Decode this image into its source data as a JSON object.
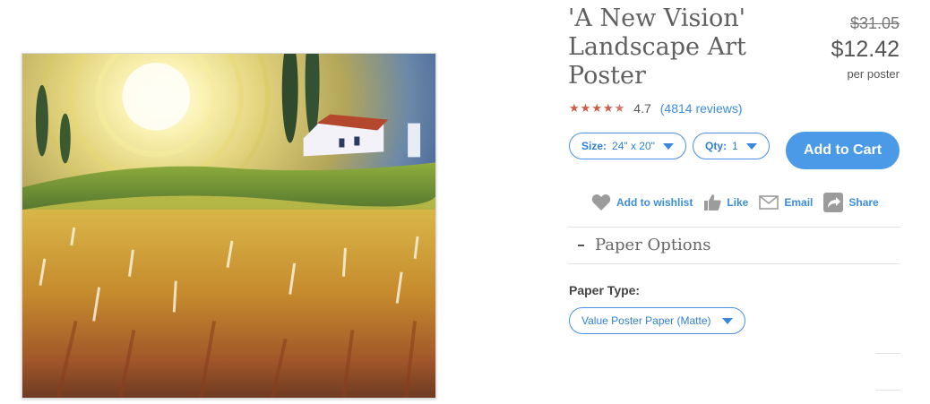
{
  "product": {
    "title": "'A New Vision' Landscape Art Poster",
    "price_old": "$31.05",
    "price_new": "$12.42",
    "price_unit": "per poster",
    "image_alt": "A New Vision painting"
  },
  "rating": {
    "stars": 4.7,
    "value": "4.7",
    "reviews": "(4814 reviews)",
    "star_color": "#cd5b45"
  },
  "options": {
    "size_key": "Size:",
    "size_value": "24\" x 20\"",
    "qty_key": "Qty:",
    "qty_value": "1",
    "add_to_cart": "Add to Cart"
  },
  "actions": {
    "wishlist": "Add to wishlist",
    "like": "Like",
    "email": "Email",
    "share": "Share"
  },
  "paper_options": {
    "section_title": "Paper Options",
    "paper_type_label": "Paper Type:",
    "paper_type_value": "Value Poster Paper (Matte)"
  },
  "colors": {
    "accent": "#4a9ae8",
    "link": "#3c8dde"
  }
}
